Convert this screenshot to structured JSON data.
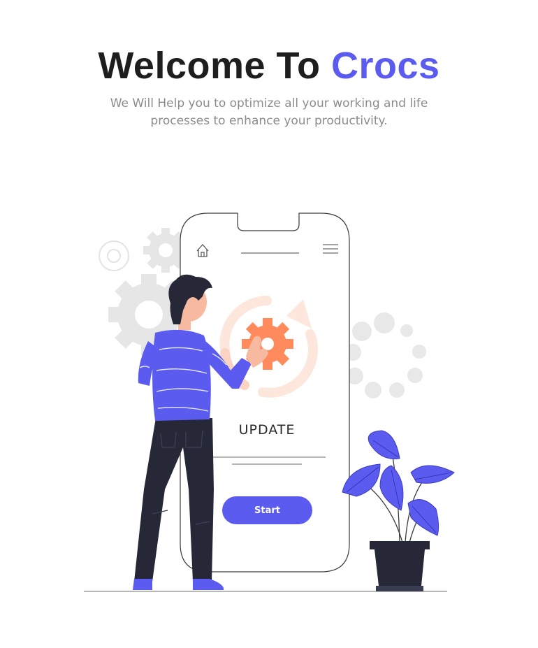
{
  "hero": {
    "title_prefix": "Welcome To",
    "title_brand": "Crocs",
    "subtitle": "We Will Help you to optimize all your working and life processes to enhance your productivity."
  },
  "phone": {
    "label": "UPDATE",
    "start_label": "Start"
  },
  "colors": {
    "accent": "#5b5bf0",
    "title": "#1e1e1e",
    "subtitle": "#8c8c8c",
    "gear_orange": "#ff8a5c"
  },
  "icons": [
    "home-icon",
    "menu-icon",
    "gear-icon",
    "refresh-arrows-icon"
  ]
}
